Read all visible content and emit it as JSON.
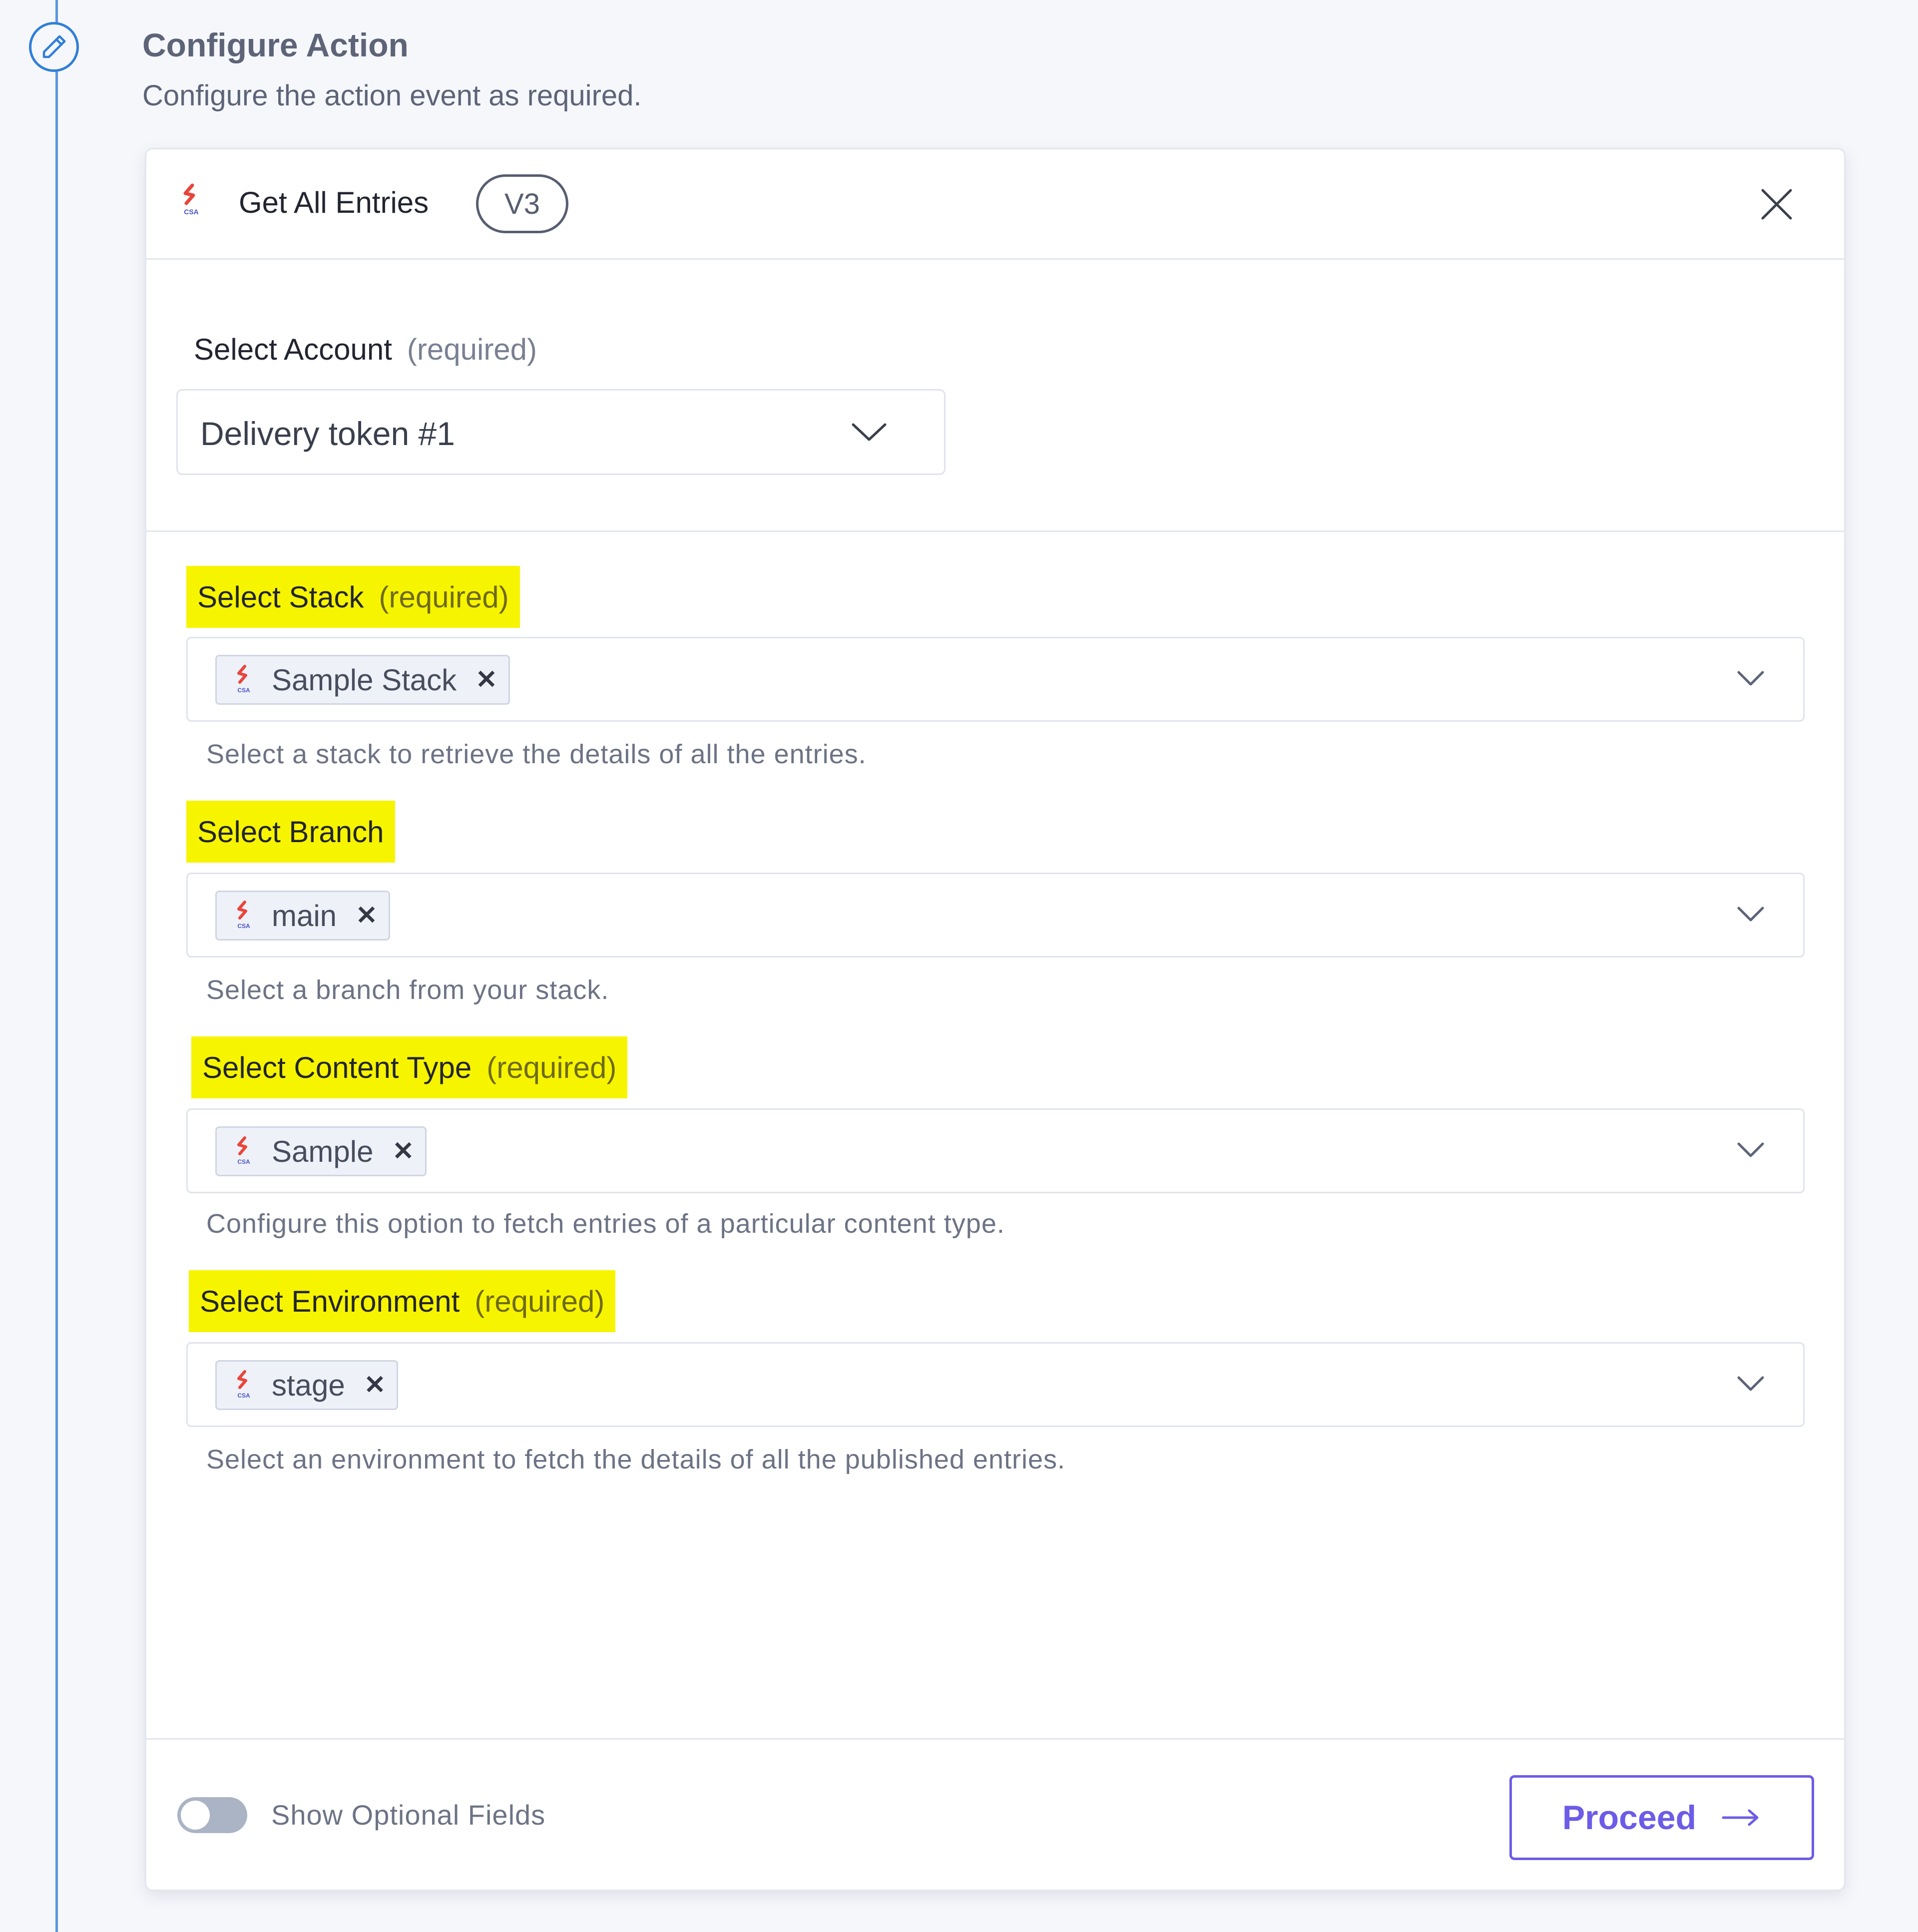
{
  "header": {
    "title": "Configure Action",
    "subtitle": "Configure the action event as required."
  },
  "card": {
    "title": "Get All Entries",
    "version": "V3",
    "logo_text": "CSA"
  },
  "account": {
    "label": "Select Account",
    "required": "(required)",
    "value": "Delivery token #1"
  },
  "fields": [
    {
      "label": "Select Stack",
      "required": "(required)",
      "tag": "Sample Stack",
      "help": "Select a stack to retrieve the details of all the entries."
    },
    {
      "label": "Select Branch",
      "required": "",
      "tag": "main",
      "help": "Select a branch from your stack."
    },
    {
      "label": "Select Content Type",
      "required": "(required)",
      "tag": "Sample",
      "help": "Configure this option to fetch entries of a particular content type."
    },
    {
      "label": "Select Environment",
      "required": "(required)",
      "tag": "stage",
      "help": "Select an environment to fetch the details of all the published entries."
    }
  ],
  "footer": {
    "toggle_label": "Show Optional Fields",
    "toggle_on": false,
    "proceed_label": "Proceed"
  },
  "colors": {
    "accent": "#6c5ce7",
    "highlight": "#f7f400",
    "timeline": "#5a95e6"
  }
}
